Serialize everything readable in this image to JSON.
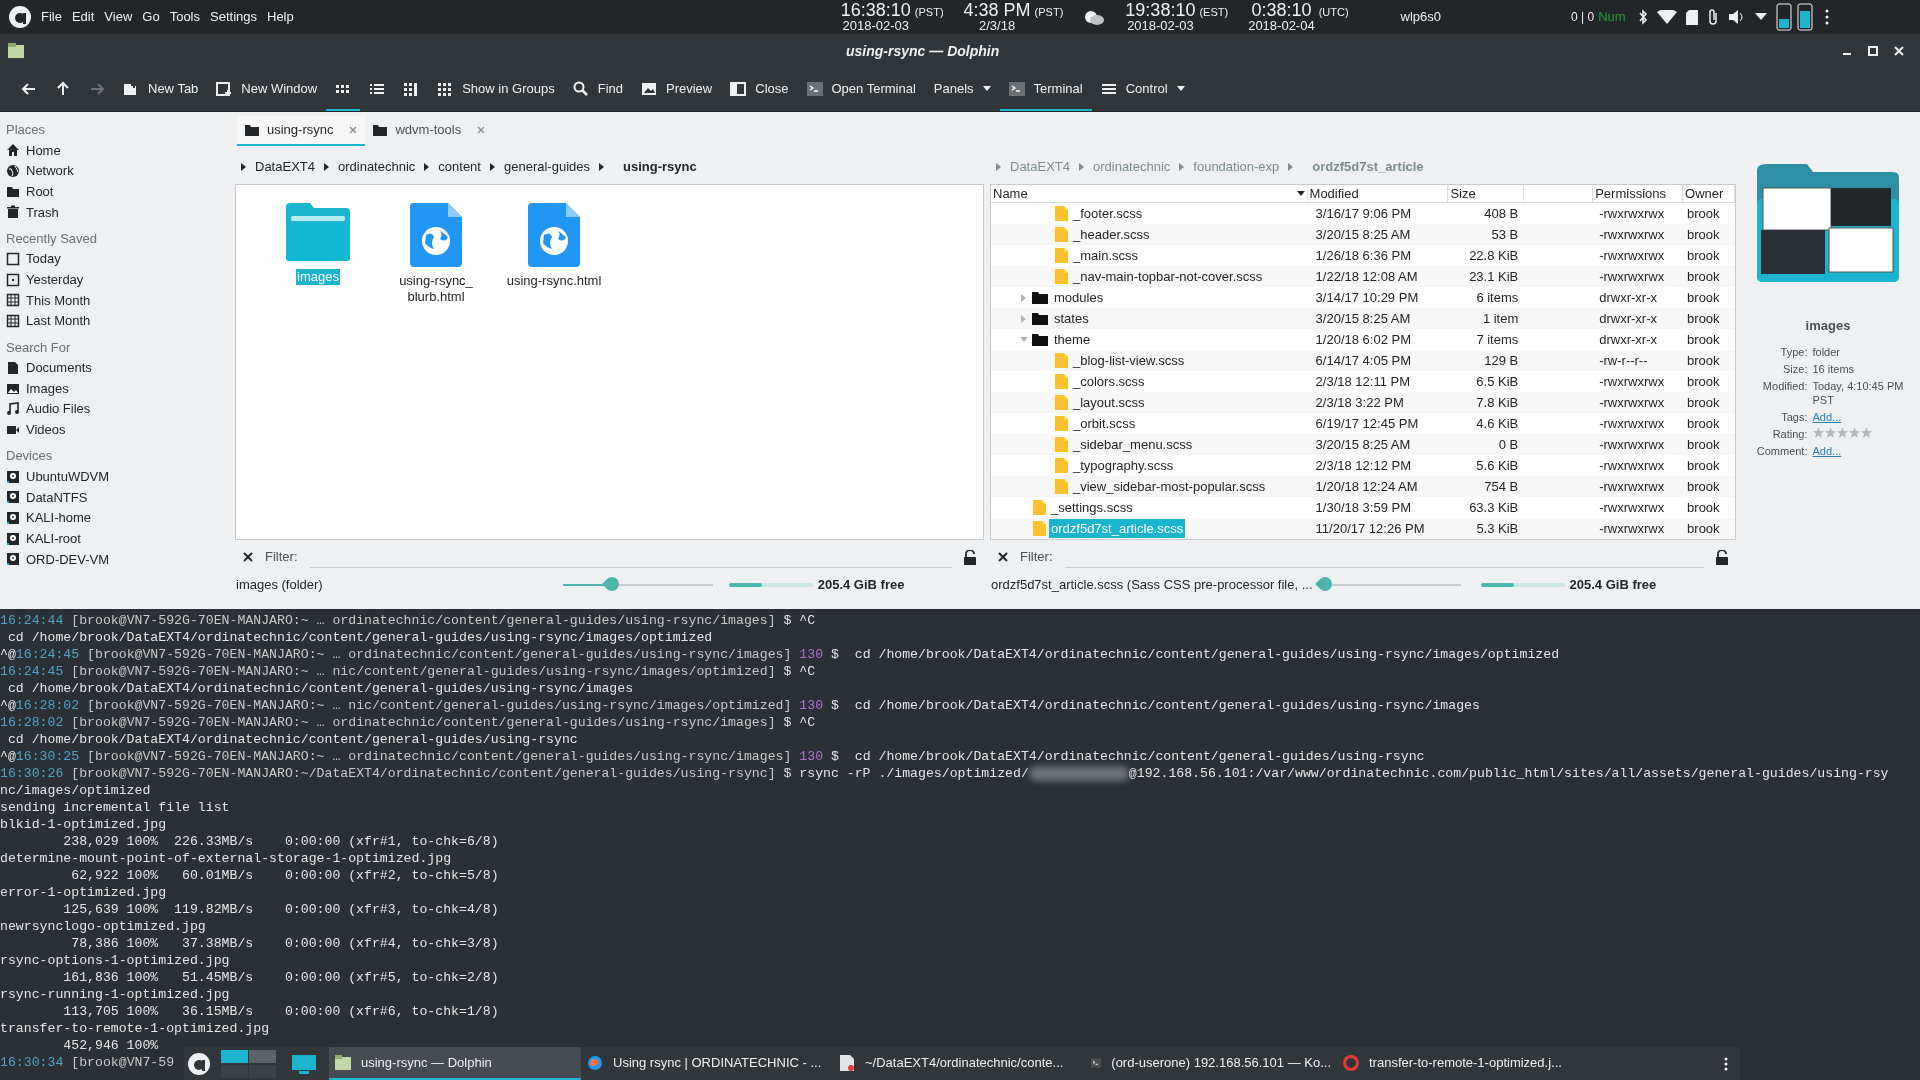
{
  "top_panel": {
    "menu": [
      "File",
      "Edit",
      "View",
      "Go",
      "Tools",
      "Settings",
      "Help"
    ],
    "clocks": [
      {
        "time": "16:38:10",
        "zone": "(PST)",
        "date": "2018-02-03"
      },
      {
        "time": "4:38 PM",
        "zone": "(PST)",
        "date": "2/3/18"
      },
      {
        "time": "19:38:10",
        "zone": "(EST)",
        "date": "2018-02-03"
      },
      {
        "time": "0:38:10",
        "zone": "(UTC)",
        "date": "2018-02-04"
      }
    ],
    "network_interface": "wlp6s0",
    "counters": "0 | 0",
    "num_lock": "Num"
  },
  "window": {
    "title": "using-rsync — Dolphin"
  },
  "toolbar": [
    {
      "kind": "back",
      "selected": false,
      "disabled": false
    },
    {
      "kind": "up",
      "selected": false,
      "disabled": false
    },
    {
      "kind": "forward",
      "selected": false,
      "disabled": true
    },
    {
      "kind": "newtab",
      "label": "New Tab",
      "selected": false,
      "disabled": false
    },
    {
      "kind": "newwindow",
      "label": "New Window",
      "selected": false,
      "disabled": false
    },
    {
      "kind": "icons",
      "selected": true,
      "disabled": false
    },
    {
      "kind": "list",
      "selected": false,
      "disabled": false
    },
    {
      "kind": "compact",
      "selected": false,
      "disabled": false
    },
    {
      "kind": "groups",
      "label": "Show in Groups",
      "selected": false,
      "disabled": false
    },
    {
      "kind": "find",
      "label": "Find",
      "selected": false,
      "disabled": false
    },
    {
      "kind": "preview",
      "label": "Preview",
      "selected": false,
      "disabled": false
    },
    {
      "kind": "close",
      "label": "Close",
      "selected": false,
      "disabled": false
    },
    {
      "kind": "terminal",
      "label": "Open Terminal",
      "selected": false,
      "disabled": false
    },
    {
      "kind": "text",
      "label": "Panels",
      "selected": false,
      "disabled": false,
      "dropdown": true
    },
    {
      "kind": "terminal",
      "label": "Terminal",
      "selected": true,
      "disabled": false
    },
    {
      "kind": "menu",
      "label": "Control",
      "selected": false,
      "disabled": false,
      "dropdown": true
    }
  ],
  "sidebar": [
    {
      "title": "Places",
      "items": [
        {
          "kind": "home",
          "label": "Home",
          "selected": false
        },
        {
          "kind": "network",
          "label": "Network",
          "selected": false
        },
        {
          "kind": "folder",
          "label": "Root",
          "selected": false
        },
        {
          "kind": "trash",
          "label": "Trash",
          "selected": false
        }
      ]
    },
    {
      "title": "Recently Saved",
      "items": [
        {
          "kind": "day",
          "label": "Today",
          "selected": false
        },
        {
          "kind": "dot",
          "label": "Yesterday",
          "selected": false
        },
        {
          "kind": "calendar",
          "label": "This Month",
          "selected": false
        },
        {
          "kind": "calendar",
          "label": "Last Month",
          "selected": false
        }
      ]
    },
    {
      "title": "Search For",
      "items": [
        {
          "kind": "document",
          "label": "Documents",
          "selected": false
        },
        {
          "kind": "image",
          "label": "Images",
          "selected": false
        },
        {
          "kind": "audio",
          "label": "Audio Files",
          "selected": false
        },
        {
          "kind": "video",
          "label": "Videos",
          "selected": false
        }
      ]
    },
    {
      "title": "Devices",
      "items": [
        {
          "kind": "drive",
          "label": "UbuntuWDVM",
          "selected": false
        },
        {
          "kind": "drive",
          "label": "DataNTFS",
          "selected": false
        },
        {
          "kind": "drive",
          "label": "KALI-home",
          "selected": false
        },
        {
          "kind": "drive",
          "label": "KALI-root",
          "selected": false
        },
        {
          "kind": "drive",
          "label": "ORD-DEV-VM",
          "selected": false
        }
      ]
    }
  ],
  "left_pane": {
    "tabs": [
      {
        "label": "using-rsync",
        "selected": true
      },
      {
        "label": "wdvm-tools",
        "selected": false
      }
    ],
    "breadcrumb": [
      "DataEXT4",
      "ordinatechnic",
      "content",
      "general-guides",
      "using-rsync"
    ],
    "items": [
      {
        "kind": "folder",
        "name": "images",
        "selected": true
      },
      {
        "kind": "html",
        "name": "using-rsync_ blurb.html",
        "selected": false
      },
      {
        "kind": "html",
        "name": "using-rsync.html",
        "selected": false
      }
    ],
    "filter_label": "Filter:",
    "status": "images (folder)",
    "zoom": {
      "level": 0.33
    },
    "space": {
      "level": 0.4,
      "text": "205.4 GiB free"
    }
  },
  "right_pane": {
    "breadcrumb": [
      "DataEXT4",
      "ordinatechnic",
      "foundation-exp",
      "ordzf5d7st_article"
    ],
    "columns": [
      "Name",
      "Modified",
      "Size",
      "Permissions",
      "Owner"
    ],
    "tree": {
      "leading_children": [
        {
          "kind": "file",
          "name": "_footer.scss",
          "modified": "3/16/17 9:06 PM",
          "size": "408 B",
          "permissions": "-rwxrwxrwx",
          "owner": "brook",
          "selected": false
        },
        {
          "kind": "file",
          "name": "_header.scss",
          "modified": "3/20/15 8:25 AM",
          "size": "53 B",
          "permissions": "-rwxrwxrwx",
          "owner": "brook",
          "selected": false
        },
        {
          "kind": "file",
          "name": "_main.scss",
          "modified": "1/26/18 6:36 PM",
          "size": "22.8 KiB",
          "permissions": "-rwxrwxrwx",
          "owner": "brook",
          "selected": false
        },
        {
          "kind": "file",
          "name": "_nav-main-topbar-not-cover.scss",
          "modified": "1/22/18 12:08 AM",
          "size": "23.1 KiB",
          "permissions": "-rwxrwxrwx",
          "owner": "brook",
          "selected": false
        }
      ],
      "items": [
        {
          "kind": "folder",
          "name": "modules",
          "modified": "3/14/17 10:29 PM",
          "size": "6 items",
          "permissions": "drwxr-xr-x",
          "owner": "brook",
          "selected": false,
          "expanded": false
        },
        {
          "kind": "folder",
          "name": "states",
          "modified": "3/20/15 8:25 AM",
          "size": "1 item",
          "permissions": "drwxr-xr-x",
          "owner": "brook",
          "selected": false,
          "expanded": false
        },
        {
          "kind": "folder",
          "name": "theme",
          "modified": "1/20/18 6:02 PM",
          "size": "7 items",
          "permissions": "drwxr-xr-x",
          "owner": "brook",
          "selected": false,
          "expanded": true,
          "children": [
            {
              "kind": "file",
              "name": "_blog-list-view.scss",
              "modified": "6/14/17 4:05 PM",
              "size": "129 B",
              "permissions": "-rw-r--r--",
              "owner": "brook",
              "selected": false
            },
            {
              "kind": "file",
              "name": "_colors.scss",
              "modified": "2/3/18 12:11 PM",
              "size": "6.5 KiB",
              "permissions": "-rwxrwxrwx",
              "owner": "brook",
              "selected": false
            },
            {
              "kind": "file",
              "name": "_layout.scss",
              "modified": "2/3/18 3:22 PM",
              "size": "7.8 KiB",
              "permissions": "-rwxrwxrwx",
              "owner": "brook",
              "selected": false
            },
            {
              "kind": "file",
              "name": "_orbit.scss",
              "modified": "6/19/17 12:45 PM",
              "size": "4.6 KiB",
              "permissions": "-rwxrwxrwx",
              "owner": "brook",
              "selected": false
            },
            {
              "kind": "file",
              "name": "_sidebar_menu.scss",
              "modified": "3/20/15 8:25 AM",
              "size": "0 B",
              "permissions": "-rwxrwxrwx",
              "owner": "brook",
              "selected": false
            },
            {
              "kind": "file",
              "name": "_typography.scss",
              "modified": "2/3/18 12:12 PM",
              "size": "5.6 KiB",
              "permissions": "-rwxrwxrwx",
              "owner": "brook",
              "selected": false
            },
            {
              "kind": "file",
              "name": "_view_sidebar-most-popular.scss",
              "modified": "1/20/18 12:24 AM",
              "size": "754 B",
              "permissions": "-rwxrwxrwx",
              "owner": "brook",
              "selected": false
            }
          ]
        },
        {
          "kind": "file",
          "name": "_settings.scss",
          "modified": "1/30/18 3:59 PM",
          "size": "63.3 KiB",
          "permissions": "-rwxrwxrwx",
          "owner": "brook",
          "selected": false
        },
        {
          "kind": "file",
          "name": "ordzf5d7st_article.scss",
          "modified": "11/20/17 12:26 PM",
          "size": "5.3 KiB",
          "permissions": "-rwxrwxrwx",
          "owner": "brook",
          "selected": true
        }
      ]
    },
    "filter_label": "Filter:",
    "status": "ordzf5d7st_article.scss (Sass CSS pre-processor file, ...",
    "zoom": {
      "level": 0
    },
    "space": {
      "level": 0.4,
      "text": "205.4 GiB free"
    }
  },
  "info_panel": {
    "name": "images",
    "fields": [
      {
        "kind": "text",
        "label": "Type:",
        "value": "folder"
      },
      {
        "kind": "text",
        "label": "Size:",
        "value": "16 items"
      },
      {
        "kind": "text",
        "label": "Modified:",
        "value": "Today, 4:10:45 PM PST"
      },
      {
        "kind": "link",
        "label": "Tags:",
        "value": "Add..."
      },
      {
        "kind": "rating",
        "label": "Rating:",
        "stars": 0
      },
      {
        "kind": "link",
        "label": "Comment:",
        "value": "Add..."
      }
    ]
  },
  "terminal": [
    {
      "kind": "prompt",
      "time": "16:24:44",
      "host": "[brook@VN7-592G-70EN-MANJARO:~ … ordinatechnic/content/general-guides/using-rsync/images]",
      "cmd": "$ ^C"
    },
    {
      "kind": "plain",
      "text": " cd /home/brook/DataEXT4/ordinatechnic/content/general-guides/using-rsync/images/optimized"
    },
    {
      "kind": "prompt",
      "lead": "^@",
      "time": "16:24:45",
      "host": "[brook@VN7-592G-70EN-MANJARO:~ … ordinatechnic/content/general-guides/using-rsync/images]",
      "code": "130",
      "cmd": "$  cd /home/brook/DataEXT4/ordinatechnic/content/general-guides/using-rsync/images/optimized"
    },
    {
      "kind": "prompt",
      "time": "16:24:45",
      "host": "[brook@VN7-592G-70EN-MANJARO:~ … nic/content/general-guides/using-rsync/images/optimized]",
      "cmd": "$ ^C"
    },
    {
      "kind": "plain",
      "text": " cd /home/brook/DataEXT4/ordinatechnic/content/general-guides/using-rsync/images"
    },
    {
      "kind": "prompt",
      "lead": "^@",
      "time": "16:28:02",
      "host": "[brook@VN7-592G-70EN-MANJARO:~ … nic/content/general-guides/using-rsync/images/optimized]",
      "code": "130",
      "cmd": "$  cd /home/brook/DataEXT4/ordinatechnic/content/general-guides/using-rsync/images"
    },
    {
      "kind": "prompt",
      "time": "16:28:02",
      "host": "[brook@VN7-592G-70EN-MANJARO:~ … ordinatechnic/content/general-guides/using-rsync/images]",
      "cmd": "$ ^C"
    },
    {
      "kind": "plain",
      "text": " cd /home/brook/DataEXT4/ordinatechnic/content/general-guides/using-rsync"
    },
    {
      "kind": "prompt",
      "lead": "^@",
      "time": "16:30:25",
      "host": "[brook@VN7-592G-70EN-MANJARO:~ … ordinatechnic/content/general-guides/using-rsync/images]",
      "code": "130",
      "cmd": "$  cd /home/brook/DataEXT4/ordinatechnic/content/general-guides/using-rsync"
    },
    {
      "kind": "redacted",
      "time": "16:30:26",
      "host": "[brook@VN7-592G-70EN-MANJARO:~/DataEXT4/ordinatechnic/content/general-guides/using-rsync]",
      "before": "$ rsync -rP ./images/optimized/",
      "after": "@192.168.56.101:/var/www/ordinatechnic.com/public_html/sites/all/assets/general-guides/using-rsy"
    },
    {
      "kind": "plain",
      "text": "nc/images/optimized"
    },
    {
      "kind": "plain",
      "text": "sending incremental file list"
    },
    {
      "kind": "plain",
      "text": "blkid-1-optimized.jpg"
    },
    {
      "kind": "plain",
      "text": "        238,029 100%  226.33MB/s    0:00:00 (xfr#1, to-chk=6/8)"
    },
    {
      "kind": "plain",
      "text": "determine-mount-point-of-external-storage-1-optimized.jpg"
    },
    {
      "kind": "plain",
      "text": "         62,922 100%   60.01MB/s    0:00:00 (xfr#2, to-chk=5/8)"
    },
    {
      "kind": "plain",
      "text": "error-1-optimized.jpg"
    },
    {
      "kind": "plain",
      "text": "        125,639 100%  119.82MB/s    0:00:00 (xfr#3, to-chk=4/8)"
    },
    {
      "kind": "plain",
      "text": "newrsynclogo-optimized.jpg"
    },
    {
      "kind": "plain",
      "text": "         78,386 100%   37.38MB/s    0:00:00 (xfr#4, to-chk=3/8)"
    },
    {
      "kind": "plain",
      "text": "rsync-options-1-optimized.jpg"
    },
    {
      "kind": "plain",
      "text": "        161,836 100%   51.45MB/s    0:00:00 (xfr#5, to-chk=2/8)"
    },
    {
      "kind": "plain",
      "text": "rsync-running-1-optimized.jpg"
    },
    {
      "kind": "plain",
      "text": "        113,705 100%   36.15MB/s    0:00:00 (xfr#6, to-chk=1/8)"
    },
    {
      "kind": "plain",
      "text": "transfer-to-remote-1-optimized.jpg"
    },
    {
      "kind": "plain",
      "text": "        452,946 100%"
    },
    {
      "kind": "prompt",
      "time": "16:30:34",
      "host": "[brook@VN7-59"
    }
  ],
  "taskbar": {
    "tasks": [
      {
        "kind": "files",
        "label": "using-rsync — Dolphin",
        "selected": true
      },
      {
        "kind": "browser",
        "label": "Using rsync | ORDINATECHNIC - ...",
        "selected": false
      },
      {
        "kind": "editor",
        "label": "~/DataEXT4/ordinatechnic/conte...",
        "selected": false
      },
      {
        "kind": "terminal",
        "label": "(ord-userone) 192.168.56.101 — Ko...",
        "selected": false
      },
      {
        "kind": "viewer",
        "label": "transfer-to-remote-1-optimized.j...",
        "selected": false
      }
    ]
  }
}
